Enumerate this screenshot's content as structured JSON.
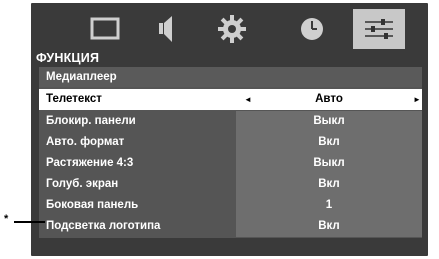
{
  "menu": {
    "section_title": "ФУНКЦИЯ",
    "header": "Медиаплеер",
    "tabs": [
      {
        "name": "picture-icon",
        "selected": false
      },
      {
        "name": "sound-icon",
        "selected": false
      },
      {
        "name": "setup-gear-icon",
        "selected": false
      },
      {
        "name": "timer-clock-icon",
        "selected": false
      },
      {
        "name": "function-sliders-icon",
        "selected": true
      }
    ],
    "rows": [
      {
        "label": "Телетекст",
        "value": "Авто",
        "selected": true
      },
      {
        "label": "Блокир. панели",
        "value": "Выкл",
        "selected": false
      },
      {
        "label": "Авто. формат",
        "value": "Вкл",
        "selected": false
      },
      {
        "label": "Растяжение 4:3",
        "value": "Выкл",
        "selected": false
      },
      {
        "label": "Голуб. экран",
        "value": "Вкл",
        "selected": false
      },
      {
        "label": "Боковая панель",
        "value": "1",
        "selected": false
      },
      {
        "label": "Подсветка логотипа",
        "value": "Вкл",
        "selected": false
      }
    ],
    "arrow_left": "◄",
    "arrow_right": "►"
  },
  "annotation": {
    "marker": "*"
  },
  "colors": {
    "screen_bg": "#3a3a3a",
    "panel_bg": "#555555",
    "value_bg": "#6e6e6e",
    "highlight": "#ffffff",
    "tab_selected": "#c8c8c8"
  }
}
